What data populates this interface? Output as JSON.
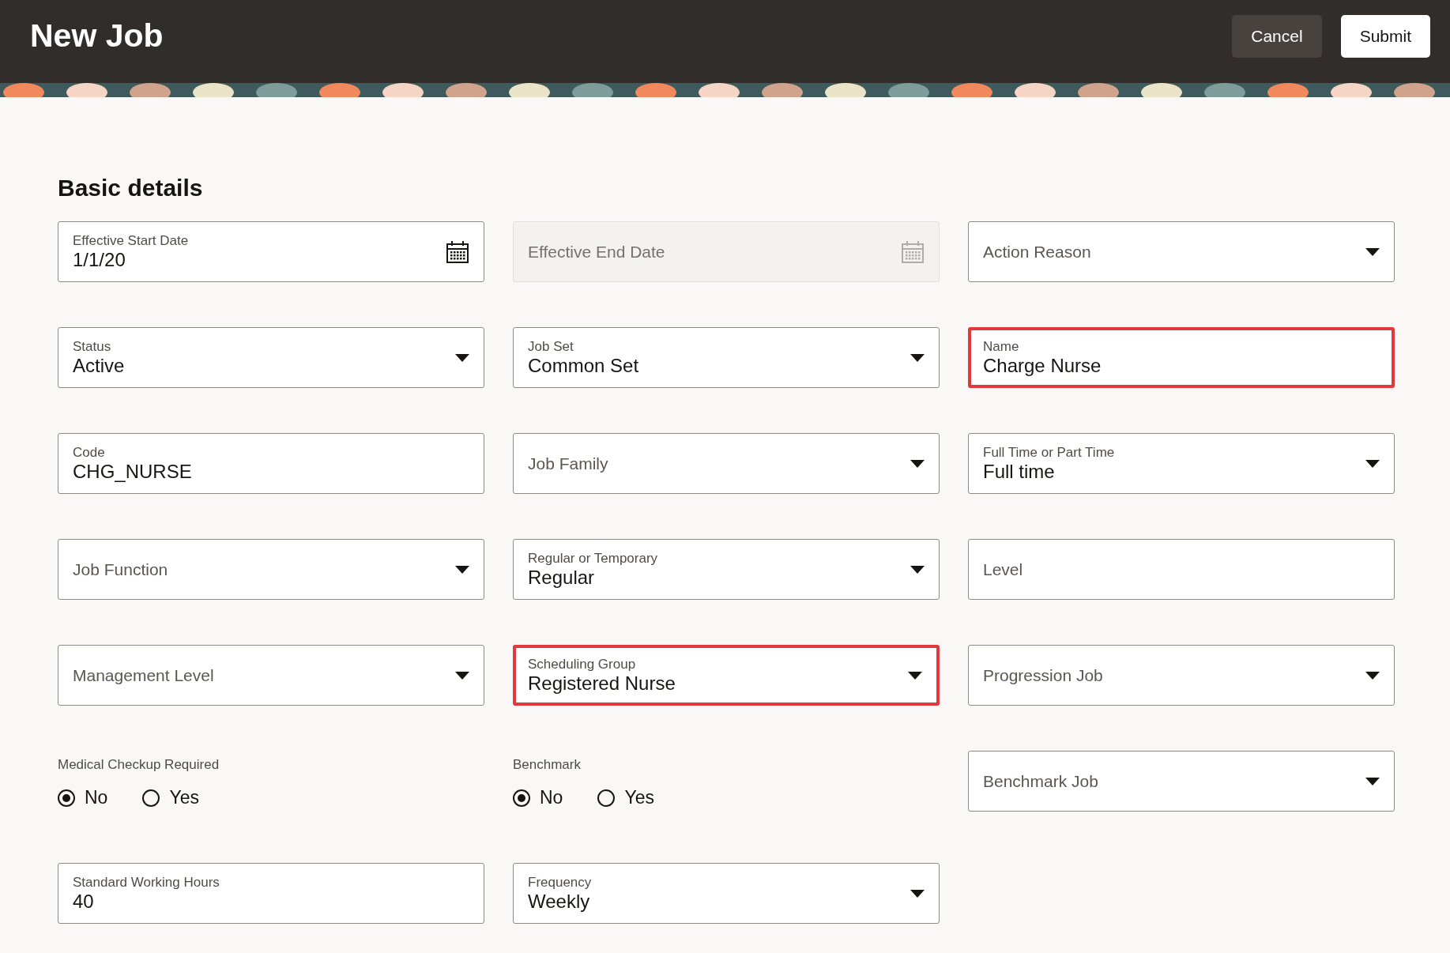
{
  "header": {
    "title": "New Job",
    "buttons": [
      {
        "label": "Cancel",
        "kind": "secondary"
      },
      {
        "label": "Submit",
        "kind": "primary"
      }
    ]
  },
  "section": {
    "title": "Basic details"
  },
  "fields": [
    {
      "kind": "date",
      "label": "Effective Start Date",
      "value": "1/1/20",
      "disabled": false,
      "highlighted": false
    },
    {
      "kind": "date",
      "label": "Effective End Date",
      "disabled": true,
      "highlighted": false
    },
    {
      "kind": "select",
      "label": "Action Reason",
      "disabled": false,
      "highlighted": false
    },
    {
      "kind": "select",
      "label": "Status",
      "value": "Active",
      "disabled": false,
      "highlighted": false
    },
    {
      "kind": "select",
      "label": "Job Set",
      "value": "Common Set",
      "disabled": false,
      "highlighted": false
    },
    {
      "kind": "text",
      "label": "Name",
      "value": "Charge Nurse",
      "disabled": false,
      "highlighted": true
    },
    {
      "kind": "text",
      "label": "Code",
      "value": "CHG_NURSE",
      "disabled": false,
      "highlighted": false
    },
    {
      "kind": "select",
      "label": "Job Family",
      "disabled": false,
      "highlighted": false
    },
    {
      "kind": "select",
      "label": "Full Time or Part Time",
      "value": "Full time",
      "disabled": false,
      "highlighted": false
    },
    {
      "kind": "select",
      "label": "Job Function",
      "disabled": false,
      "highlighted": false
    },
    {
      "kind": "select",
      "label": "Regular or Temporary",
      "value": "Regular",
      "disabled": false,
      "highlighted": false
    },
    {
      "kind": "text",
      "label": "Level",
      "disabled": false,
      "highlighted": false
    },
    {
      "kind": "select",
      "label": "Management Level",
      "disabled": false,
      "highlighted": false
    },
    {
      "kind": "select",
      "label": "Scheduling Group",
      "value": "Registered Nurse",
      "disabled": false,
      "highlighted": true
    },
    {
      "kind": "select",
      "label": "Progression Job",
      "disabled": false,
      "highlighted": false
    },
    {
      "kind": "radio",
      "label": "Medical Checkup Required",
      "options": [
        {
          "label": "No",
          "selected": true
        },
        {
          "label": "Yes",
          "selected": false
        }
      ]
    },
    {
      "kind": "radio",
      "label": "Benchmark",
      "options": [
        {
          "label": "No",
          "selected": true
        },
        {
          "label": "Yes",
          "selected": false
        }
      ]
    },
    {
      "kind": "select",
      "label": "Benchmark Job",
      "disabled": false,
      "highlighted": false
    },
    {
      "kind": "text",
      "label": "Standard Working Hours",
      "value": "40",
      "disabled": false,
      "highlighted": false
    },
    {
      "kind": "select",
      "label": "Frequency",
      "value": "Weekly",
      "disabled": false,
      "highlighted": false
    }
  ]
}
